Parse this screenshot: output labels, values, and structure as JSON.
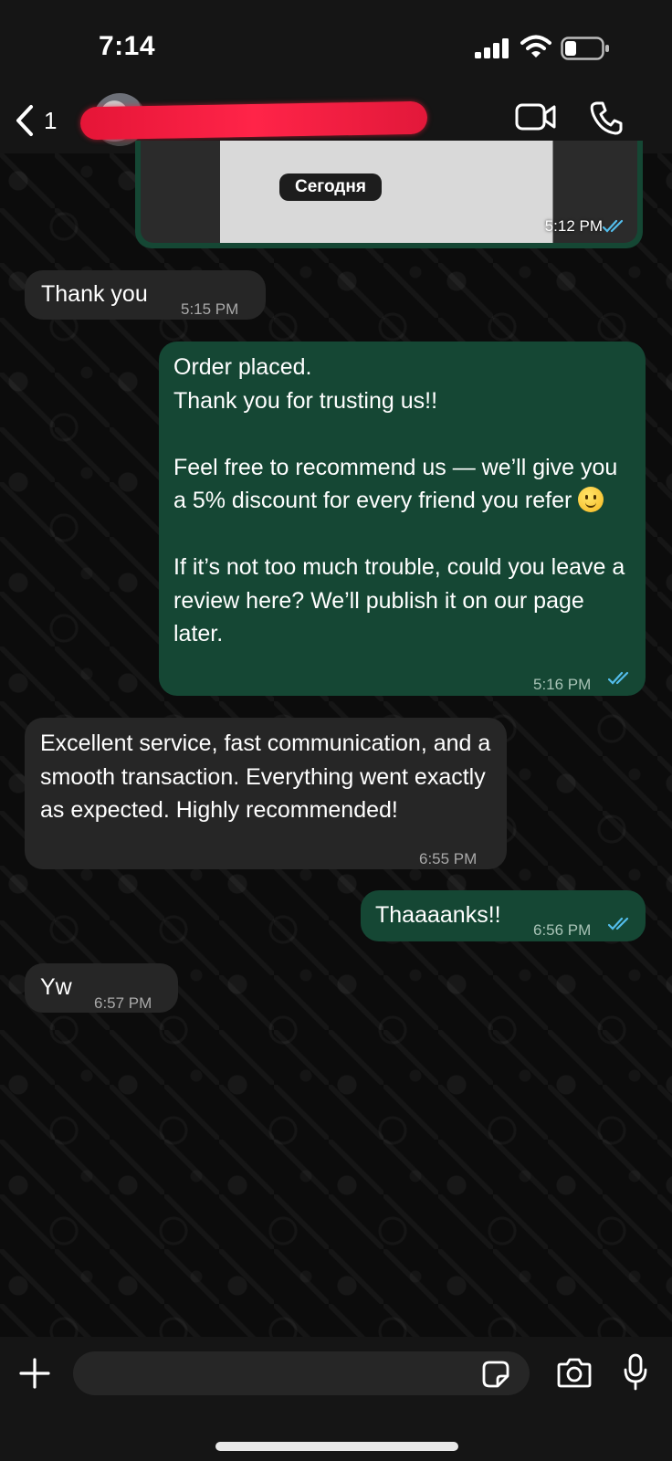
{
  "status_bar": {
    "time": "7:14"
  },
  "header": {
    "back_count": "1"
  },
  "chat": {
    "date_chip": "Сегодня",
    "image_message": {
      "time": "5:12 PM"
    },
    "messages": [
      {
        "direction": "incoming",
        "text": "Thank you",
        "time": "5:15 PM"
      },
      {
        "direction": "outgoing",
        "text": "Order placed.\nThank you for trusting us!!\n\nFeel free to recommend us — we’ll give you a 5% discount for every friend you refer",
        "text_after_emoji": "\n\nIf it’s not too much trouble, could you leave a review here? We’ll publish it on our page later.",
        "emoji": "slightly-smiling-face",
        "time": "5:16 PM"
      },
      {
        "direction": "incoming",
        "text": "Excellent service, fast communication, and a smooth transaction. Everything went exactly as expected. Highly recommended!",
        "time": "6:55 PM"
      },
      {
        "direction": "outgoing",
        "text": "Thaaaanks!!",
        "time": "6:56 PM"
      },
      {
        "direction": "incoming",
        "text": "Yw",
        "time": "6:57 PM"
      }
    ]
  },
  "input_bar": {
    "message_value": "",
    "icons": [
      "plus-icon",
      "sticker-icon",
      "camera-icon",
      "microphone-icon"
    ]
  },
  "colors": {
    "outgoing_bubble": "#154734",
    "incoming_bubble": "#262626",
    "read_ticks": "#53bdeb"
  }
}
